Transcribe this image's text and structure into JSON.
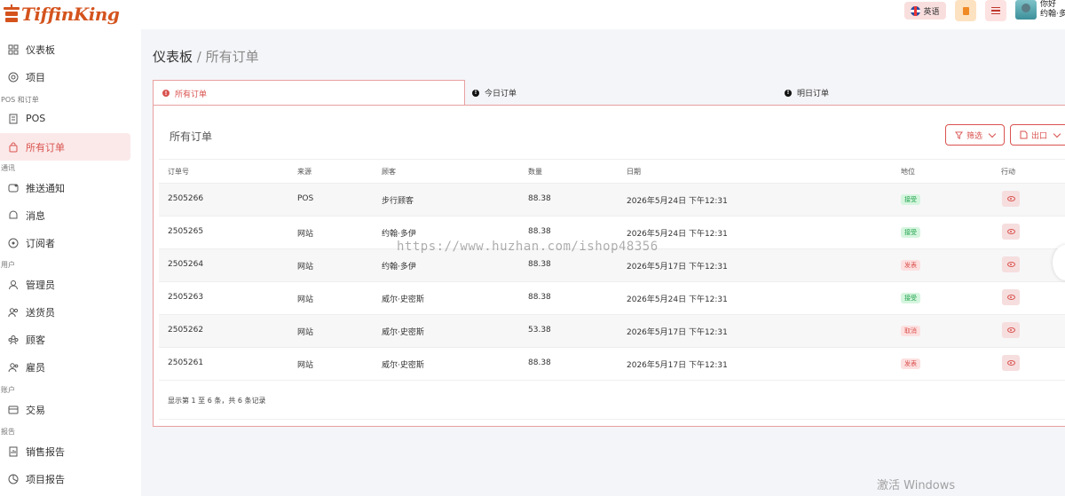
{
  "app": {
    "logo_text": "TiffinKing"
  },
  "topbar": {
    "language_label": "英语",
    "greeting": "你好",
    "user_name": "约翰·多"
  },
  "sidebar": {
    "items": [
      {
        "label": "仪表板",
        "icon": "dashboard-icon"
      },
      {
        "label": "项目",
        "icon": "items-icon"
      },
      {
        "section": "POS 和订单"
      },
      {
        "label": "POS",
        "icon": "pos-icon"
      },
      {
        "label": "所有订单",
        "icon": "orders-bag-icon",
        "active": true
      },
      {
        "section": "通讯"
      },
      {
        "label": "推送通知",
        "icon": "push-notification-icon"
      },
      {
        "label": "消息",
        "icon": "message-icon"
      },
      {
        "label": "订阅者",
        "icon": "subscriber-icon"
      },
      {
        "section": "用户"
      },
      {
        "label": "管理员",
        "icon": "admin-icon"
      },
      {
        "label": "送货员",
        "icon": "delivery-man-icon"
      },
      {
        "label": "顾客",
        "icon": "customers-icon"
      },
      {
        "label": "雇员",
        "icon": "employee-icon"
      },
      {
        "section": "账户"
      },
      {
        "label": "交易",
        "icon": "transaction-icon"
      },
      {
        "section": "报告"
      },
      {
        "label": "销售报告",
        "icon": "sales-report-icon"
      },
      {
        "label": "项目报告",
        "icon": "items-report-icon"
      }
    ]
  },
  "breadcrumb": {
    "root": "仪表板",
    "separator": "/",
    "current": "所有订单"
  },
  "tabs": [
    {
      "label": "所有订单",
      "active": true
    },
    {
      "label": "今日订单",
      "active": false
    },
    {
      "label": "明日订单",
      "active": false
    }
  ],
  "panel": {
    "title": "所有订单",
    "filter_label": "筛选",
    "export_label": "出口"
  },
  "table": {
    "columns": [
      "订单号",
      "来源",
      "顾客",
      "数量",
      "日期",
      "地位",
      "行动"
    ],
    "rows": [
      {
        "id": "2505266",
        "source": "POS",
        "customer": "步行顾客",
        "amount": "88.38",
        "date": "2026年5月24日 下午12:31",
        "status": "接受",
        "status_color": "green"
      },
      {
        "id": "2505265",
        "source": "网站",
        "customer": "约翰·多伊",
        "amount": "88.38",
        "date": "2026年5月24日 下午12:31",
        "status": "接受",
        "status_color": "green"
      },
      {
        "id": "2505264",
        "source": "网站",
        "customer": "约翰·多伊",
        "amount": "88.38",
        "date": "2026年5月17日 下午12:31",
        "status": "发表",
        "status_color": "red"
      },
      {
        "id": "2505263",
        "source": "网站",
        "customer": "威尔·史密斯",
        "amount": "88.38",
        "date": "2026年5月24日 下午12:31",
        "status": "接受",
        "status_color": "green"
      },
      {
        "id": "2505262",
        "source": "网站",
        "customer": "威尔·史密斯",
        "amount": "53.38",
        "date": "2026年5月17日 下午12:31",
        "status": "取消",
        "status_color": "red"
      },
      {
        "id": "2505261",
        "source": "网站",
        "customer": "威尔·史密斯",
        "amount": "88.38",
        "date": "2026年5月17日 下午12:31",
        "status": "发表",
        "status_color": "red"
      }
    ],
    "summary": "显示第 1 至 6 条，共 6 条记录"
  },
  "watermark": "https://www.huzhan.com/ishop48356",
  "os_watermark": "激活 Windows",
  "colors": {
    "accent": "#d9534f",
    "brand": "#d4531d",
    "success": "#1fa24a"
  }
}
